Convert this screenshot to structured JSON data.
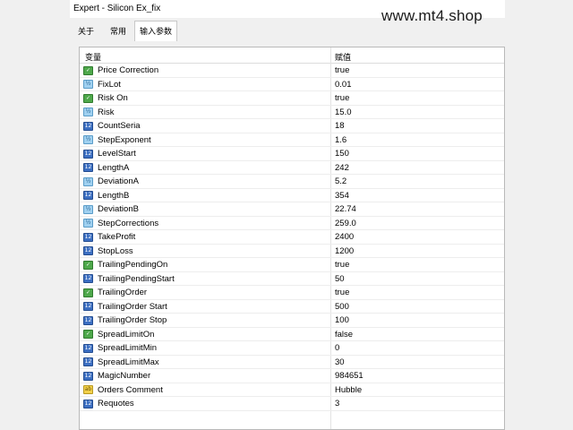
{
  "window": {
    "title": "Expert - Silicon Ex_fix"
  },
  "watermark": "www.mt4.shop",
  "tabs": [
    {
      "label": "关于",
      "active": false
    },
    {
      "label": "常用",
      "active": false
    },
    {
      "label": "输入参数",
      "active": true
    }
  ],
  "grid": {
    "columns": {
      "variable": "变量",
      "value": "赋值"
    },
    "rows": [
      {
        "name": "Price Correction",
        "value": "true",
        "icon": "bool-icon"
      },
      {
        "name": "FixLot",
        "value": "0.01",
        "icon": "double-icon"
      },
      {
        "name": "Risk On",
        "value": "true",
        "icon": "bool-icon"
      },
      {
        "name": "Risk",
        "value": "15.0",
        "icon": "double-icon"
      },
      {
        "name": "CountSeria",
        "value": "18",
        "icon": "int-icon"
      },
      {
        "name": "StepExponent",
        "value": "1.6",
        "icon": "double-icon"
      },
      {
        "name": "LevelStart",
        "value": "150",
        "icon": "int-icon"
      },
      {
        "name": "LengthA",
        "value": "242",
        "icon": "int-icon"
      },
      {
        "name": "DeviationA",
        "value": "5.2",
        "icon": "double-icon"
      },
      {
        "name": "LengthB",
        "value": "354",
        "icon": "int-icon"
      },
      {
        "name": "DeviationB",
        "value": "22.74",
        "icon": "double-icon"
      },
      {
        "name": "StepCorrections",
        "value": "259.0",
        "icon": "double-icon"
      },
      {
        "name": "TakeProfit",
        "value": "2400",
        "icon": "int-icon"
      },
      {
        "name": "StopLoss",
        "value": "1200",
        "icon": "int-icon"
      },
      {
        "name": "TrailingPendingOn",
        "value": "true",
        "icon": "bool-icon"
      },
      {
        "name": "TrailingPendingStart",
        "value": "50",
        "icon": "int-icon"
      },
      {
        "name": "TrailingOrder",
        "value": "true",
        "icon": "bool-icon"
      },
      {
        "name": "TrailingOrder Start",
        "value": "500",
        "icon": "int-icon"
      },
      {
        "name": "TrailingOrder Stop",
        "value": "100",
        "icon": "int-icon"
      },
      {
        "name": "SpreadLimitOn",
        "value": "false",
        "icon": "bool-icon"
      },
      {
        "name": "SpreadLimitMin",
        "value": "0",
        "icon": "int-icon"
      },
      {
        "name": "SpreadLimitMax",
        "value": "30",
        "icon": "int-icon"
      },
      {
        "name": "MagicNumber",
        "value": "984651",
        "icon": "int-icon"
      },
      {
        "name": "Orders Comment",
        "value": "Hubble",
        "icon": "string-icon"
      },
      {
        "name": "Requotes",
        "value": "3",
        "icon": "int-icon"
      }
    ]
  },
  "icon_glyphs": {
    "bool-icon": "✓",
    "double-icon": "½",
    "int-icon": "12",
    "string-icon": "ab"
  },
  "colors": {
    "bool_icon": "#4ea84b",
    "double_icon": "#9fd0f0",
    "int_icon": "#3c6fc2",
    "string_icon": "#f2d04a"
  }
}
